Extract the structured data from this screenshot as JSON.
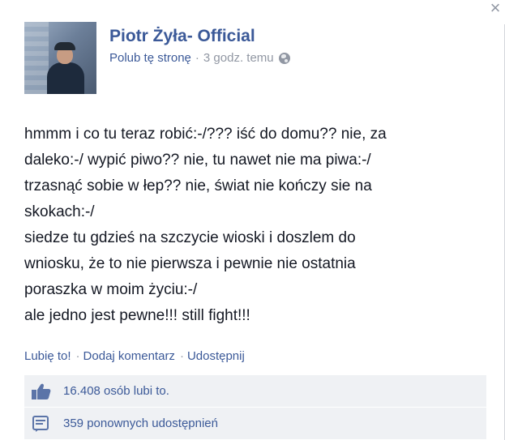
{
  "window": {
    "close_label": "×"
  },
  "post": {
    "page_name": "Piotr Żyła- Official",
    "like_page_link": "Polub tę stronę",
    "separator": "·",
    "timestamp": "3 godz. temu",
    "privacy_icon": "globe-icon",
    "message_lines": [
      "hmmm i co tu teraz robić:-/??? iść do domu?? nie, za",
      "daleko:-/ wypić piwo?? nie, tu nawet nie ma piwa:-/",
      "trzasnąć sobie w łep?? nie, świat nie kończy sie na",
      "skokach:-/",
      "siedze tu gdzieś na szczycie wioski i doszlem do",
      "wniosku, że to nie pierwsza i pewnie nie ostatnia",
      "poraszka w moim życiu:-/",
      "ale jedno jest pewne!!! still fight!!!"
    ]
  },
  "actions": {
    "like": "Lubię to!",
    "comment": "Dodaj komentarz",
    "share": "Udostępnij",
    "separator": "·"
  },
  "feedback": {
    "likes_text": "16.408 osób lubi to.",
    "shares_text": "359 ponownych udostępnień",
    "likes_icon": "thumbs-up-icon",
    "shares_icon": "share-icon"
  },
  "colors": {
    "link": "#3b5998",
    "muted": "#9197a3",
    "feedback_bg": "#eff1f4"
  }
}
